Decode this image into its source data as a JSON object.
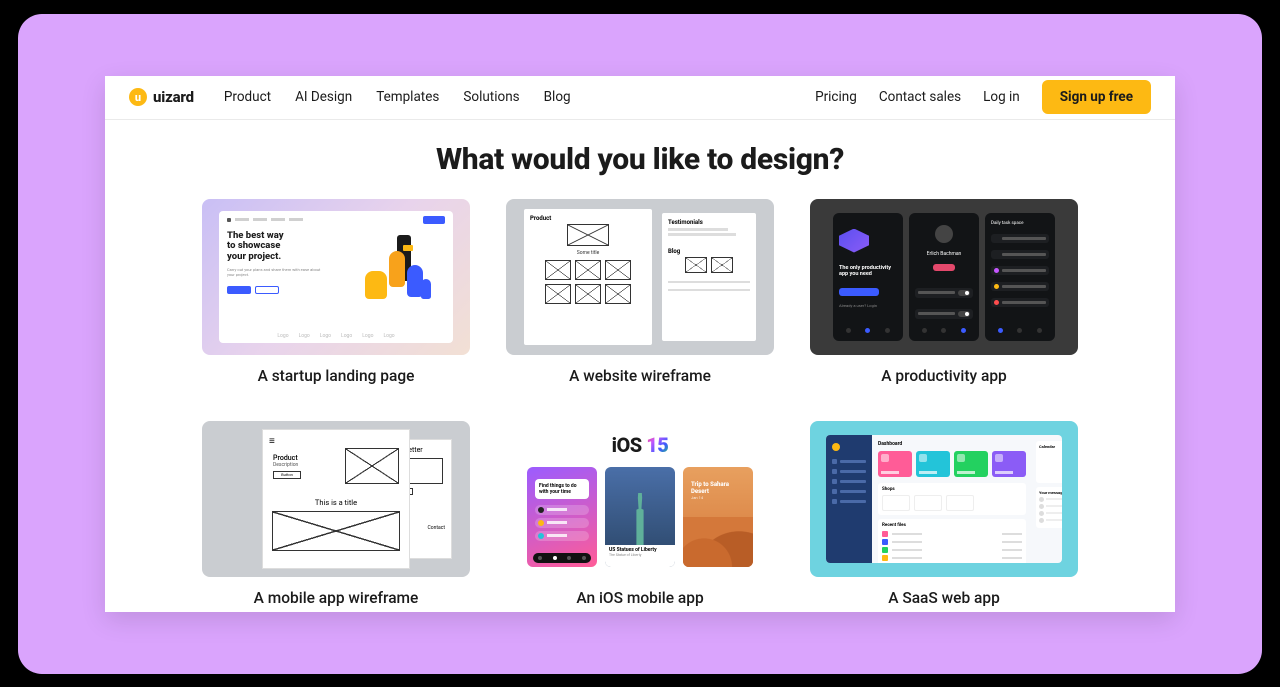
{
  "brand": {
    "mark_letter": "u",
    "name": "uizard"
  },
  "nav": {
    "left": [
      "Product",
      "AI Design",
      "Templates",
      "Solutions",
      "Blog"
    ],
    "right": [
      "Pricing",
      "Contact sales",
      "Log in"
    ],
    "signup_label": "Sign up free"
  },
  "headline": "What would you like to design?",
  "cards": [
    {
      "label": "A startup landing page"
    },
    {
      "label": "A website wireframe"
    },
    {
      "label": "A productivity app"
    },
    {
      "label": "A mobile app wireframe"
    },
    {
      "label": "An iOS mobile app"
    },
    {
      "label": "A SaaS web app"
    }
  ],
  "thumb1": {
    "title_l1": "The best way",
    "title_l2": "to showcase",
    "title_l3": "your project.",
    "logo_text": "Logo"
  },
  "thumb2": {
    "label_a": "Product",
    "label_b": "Testimonials",
    "label_c": "Blog"
  },
  "thumb3": {
    "tagline": "The only productivity app you need",
    "profile_name": "Erlich Bachman"
  },
  "thumb4": {
    "product": "Product",
    "desc": "Description",
    "button": "Button",
    "newsletter": "Newsletter",
    "title": "This is a title",
    "contact": "Contact"
  },
  "thumb5": {
    "logo_prefix": "iOS ",
    "logo_num": "15",
    "trip": "Trip to Sahara Desert"
  },
  "colors": {
    "brand_yellow": "#fdb913",
    "purple_bg": "#daa4fd"
  }
}
